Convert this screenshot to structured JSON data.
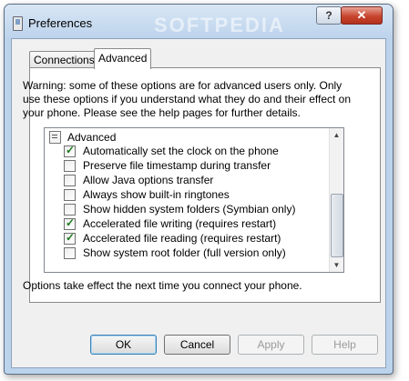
{
  "window": {
    "title": "Preferences",
    "help_label": "?",
    "close_label": "✕",
    "watermark": "SOFTPEDIA"
  },
  "tabs": [
    {
      "label": "Connections"
    },
    {
      "label": "Advanced"
    }
  ],
  "warning_text": "Warning: some of these options are for advanced users only.  Only use these options if you understand what they do and their effect on your phone.  Please see the help pages for further details.",
  "options": {
    "group_label": "Advanced",
    "items": [
      {
        "label": "Automatically set the clock on the phone",
        "checked": true
      },
      {
        "label": "Preserve file timestamp during transfer",
        "checked": false
      },
      {
        "label": "Allow Java options transfer",
        "checked": false
      },
      {
        "label": "Always show built-in ringtones",
        "checked": false
      },
      {
        "label": "Show hidden system folders (Symbian only)",
        "checked": false
      },
      {
        "label": "Accelerated file writing (requires restart)",
        "checked": true
      },
      {
        "label": "Accelerated file reading (requires restart)",
        "checked": true
      },
      {
        "label": "Show system root folder (full version only)",
        "checked": false
      }
    ]
  },
  "footer_note": "Options take effect the next time you connect your phone.",
  "buttons": {
    "ok": "OK",
    "cancel": "Cancel",
    "apply": "Apply",
    "help": "Help"
  },
  "icons": {
    "app": "app-window-icon",
    "group": "settings-list-icon",
    "scroll_up": "scroll-up-arrow-icon",
    "scroll_down": "scroll-down-arrow-icon"
  }
}
